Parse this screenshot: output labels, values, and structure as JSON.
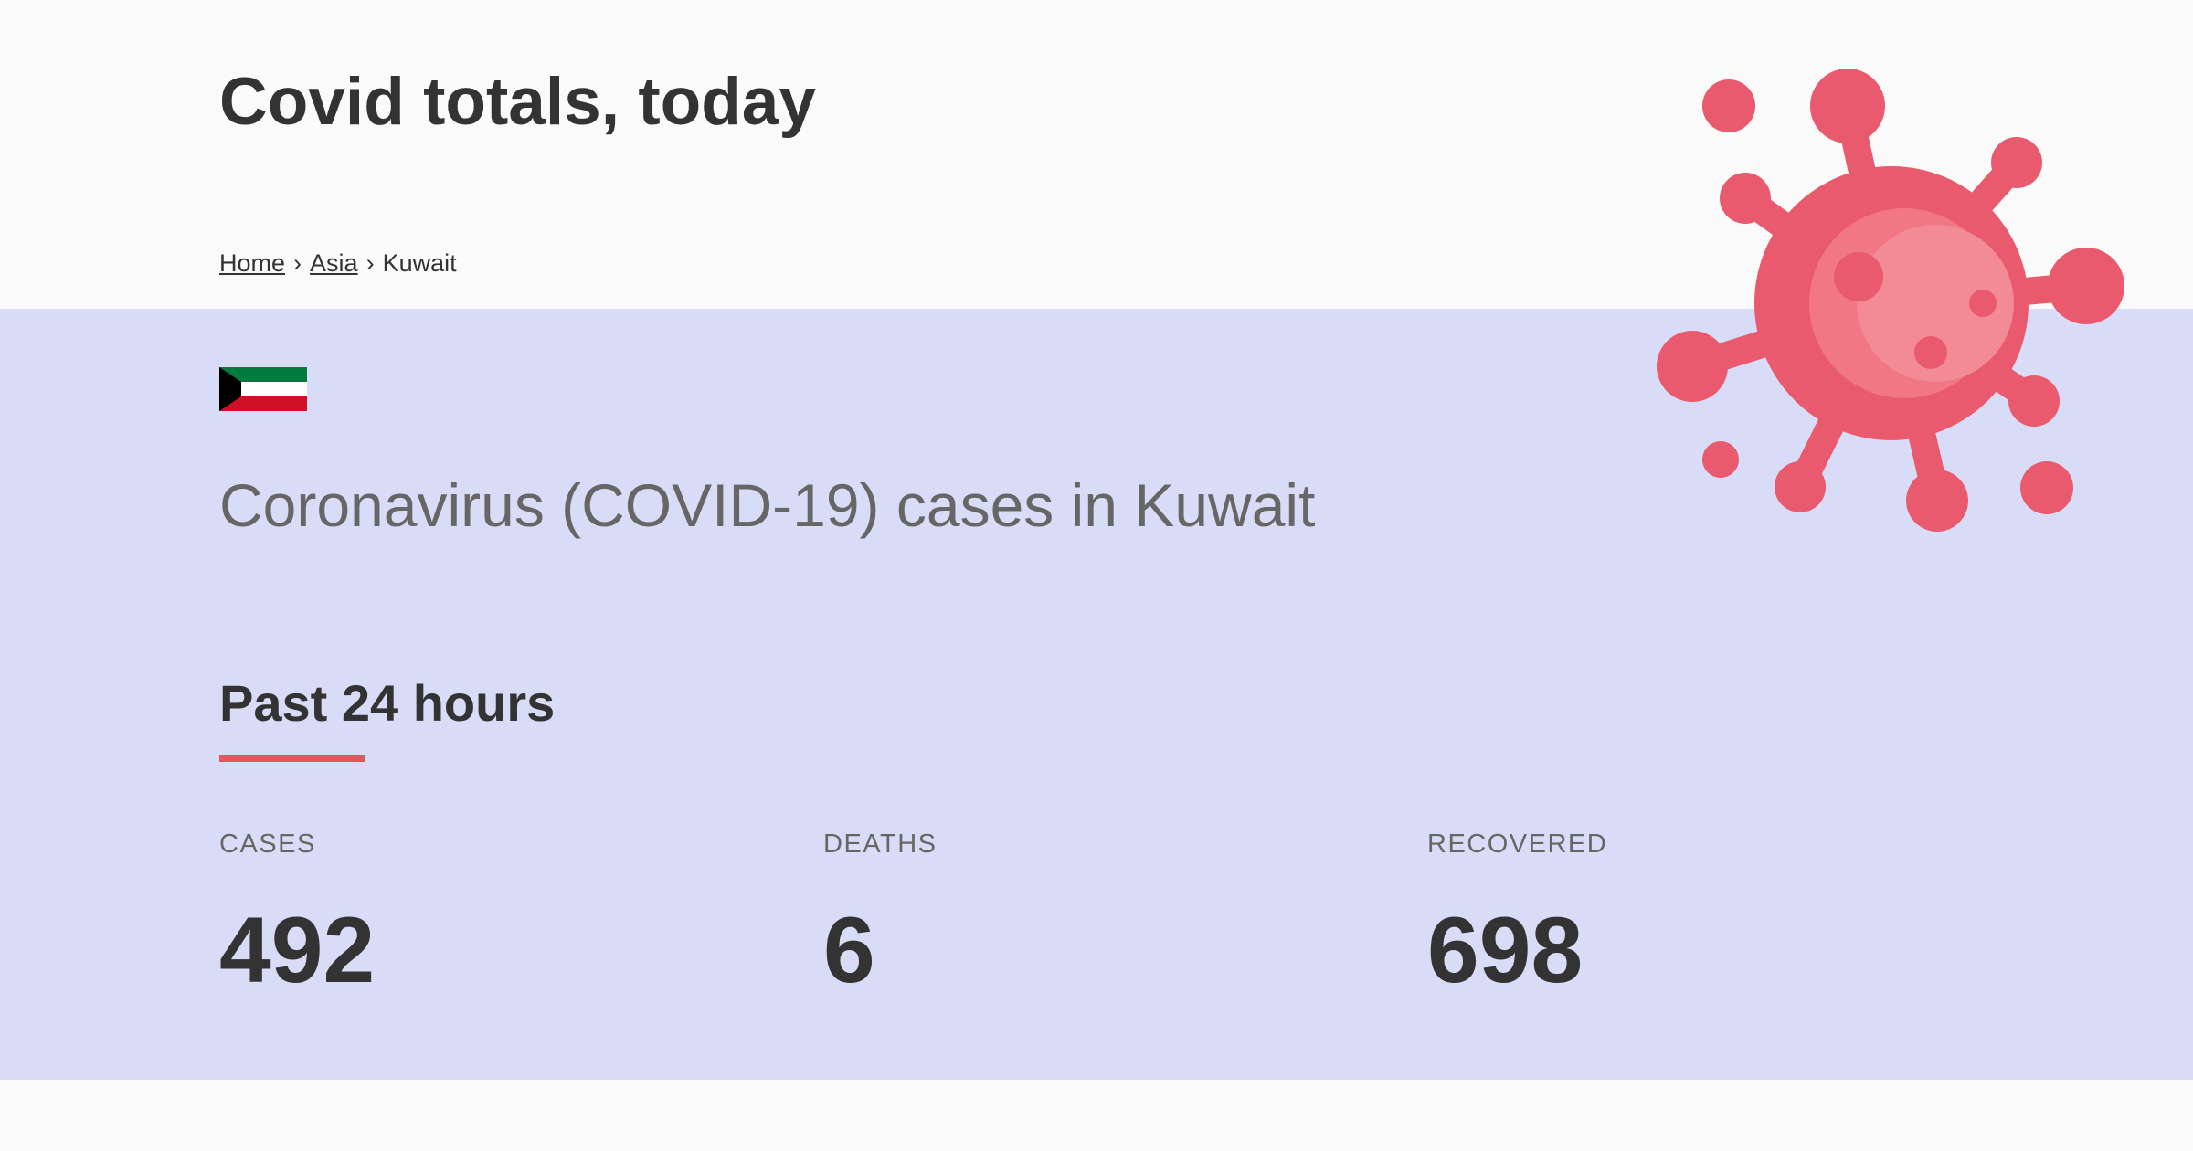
{
  "site": {
    "title": "Covid totals, today"
  },
  "breadcrumb": {
    "items": [
      {
        "label": "Home"
      },
      {
        "label": "Asia"
      },
      {
        "label": "Kuwait"
      }
    ],
    "separator": "›"
  },
  "country": {
    "flag_icon": "kuwait-flag-icon",
    "heading": "Coronavirus (COVID-19) cases in Kuwait"
  },
  "past24": {
    "heading": "Past 24 hours",
    "stats": [
      {
        "label": "CASES",
        "value": "492"
      },
      {
        "label": "DEATHS",
        "value": "6"
      },
      {
        "label": "RECOVERED",
        "value": "698"
      }
    ]
  },
  "decor": {
    "illustration_icon": "virus-icon"
  },
  "colors": {
    "main_band": "#d9dcf6",
    "accent": "#ea5460",
    "virus": "#ea5a6e",
    "text_dark": "#333333",
    "text_muted": "#666666"
  }
}
